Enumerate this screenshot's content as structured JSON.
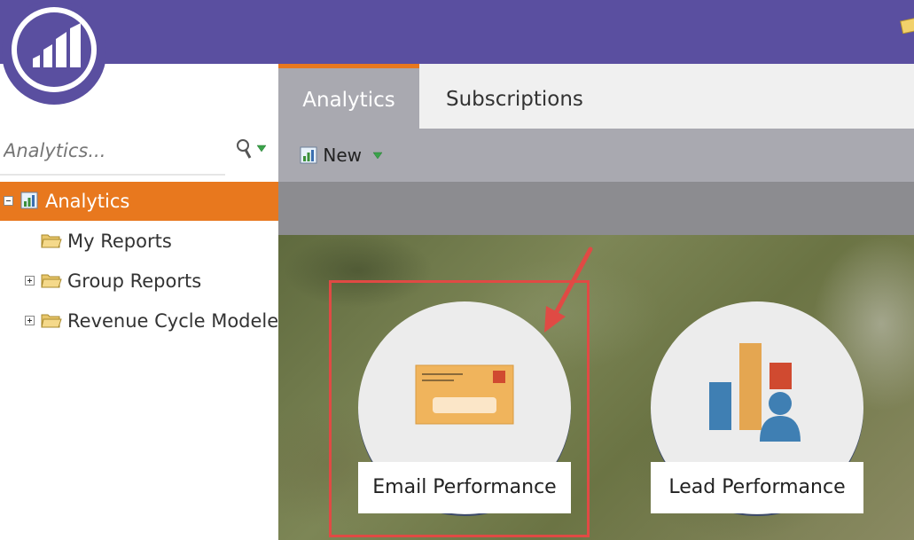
{
  "sidebar": {
    "search_placeholder": "Analytics...",
    "tree": {
      "root": "Analytics",
      "items": [
        {
          "label": "My Reports"
        },
        {
          "label": "Group Reports"
        },
        {
          "label": "Revenue Cycle Modeler"
        }
      ]
    }
  },
  "tabs": [
    {
      "label": "Analytics"
    },
    {
      "label": "Subscriptions"
    }
  ],
  "toolbar": {
    "new_label": "New"
  },
  "tiles": [
    {
      "label": "Email Performance",
      "icon": "email-icon"
    },
    {
      "label": "Lead Performance",
      "icon": "lead-chart-icon"
    }
  ],
  "colors": {
    "header": "#5a4fa0",
    "accent_orange": "#e8781e",
    "highlight_red": "#e04a44"
  }
}
